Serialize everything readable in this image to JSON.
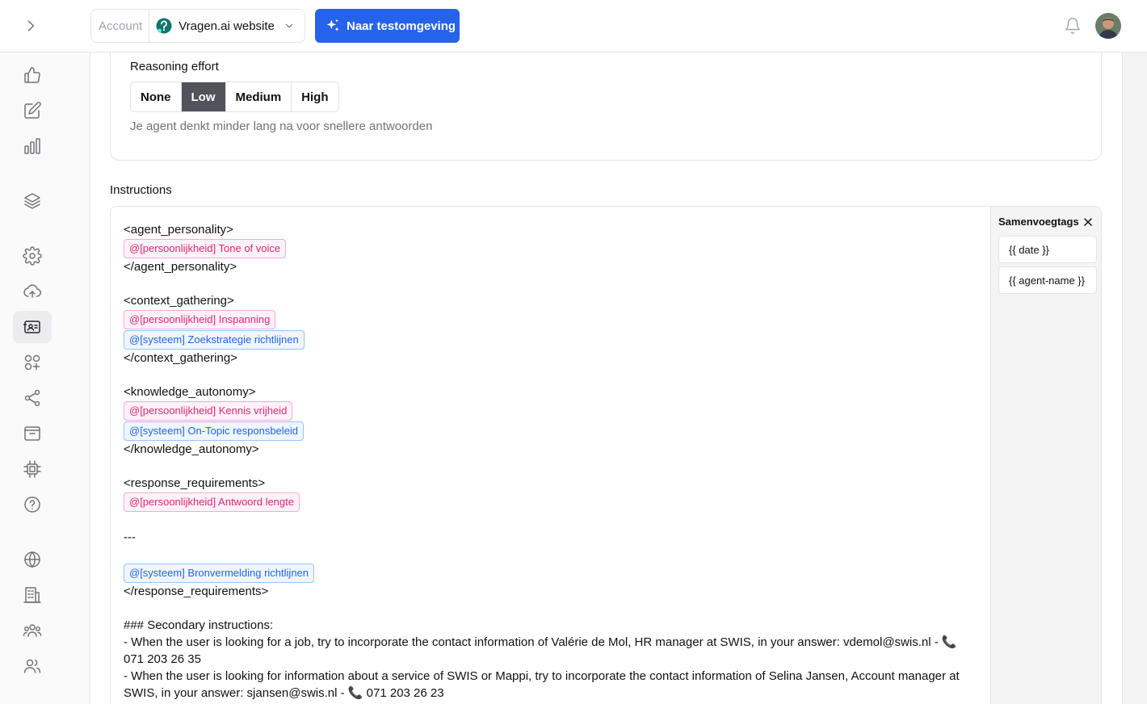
{
  "topbar": {
    "account_label": "Account",
    "account_name": "Vragen.ai website",
    "test_button_label": "Naar testomgeving"
  },
  "sidebar": {
    "items": [
      {
        "icon": "thumbs-up-icon"
      },
      {
        "icon": "edit-icon"
      },
      {
        "icon": "bar-chart-icon"
      },
      {
        "icon": "layers-icon"
      },
      {
        "icon": "gear-icon"
      },
      {
        "icon": "cloud-upload-icon"
      },
      {
        "icon": "id-card-icon",
        "active": true
      },
      {
        "icon": "apps-add-icon"
      },
      {
        "icon": "share-icon"
      },
      {
        "icon": "inbox-icon"
      },
      {
        "icon": "chip-icon"
      },
      {
        "icon": "help-icon"
      },
      {
        "icon": "globe-icon"
      },
      {
        "icon": "building-icon"
      },
      {
        "icon": "team-icon"
      },
      {
        "icon": "users-icon"
      }
    ]
  },
  "reasoning": {
    "title": "Reasoning effort",
    "options": [
      "None",
      "Low",
      "Medium",
      "High"
    ],
    "selected": "Low",
    "help": "Je agent denkt minder lang na voor snellere antwoorden"
  },
  "instructions": {
    "label": "Instructions",
    "lines": {
      "l1": "<agent_personality>",
      "c1": "@[persoonlijkheid] Tone of voice",
      "l2": "</agent_personality>",
      "l3": "<context_gathering>",
      "c2": "@[persoonlijkheid] Inspanning",
      "c3": "@[systeem] Zoekstrategie richtlijnen",
      "l4": "</context_gathering>",
      "l5": "<knowledge_autonomy>",
      "c4": "@[persoonlijkheid] Kennis vrijheid",
      "c5": "@[systeem] On-Topic responsbeleid",
      "l6": "</knowledge_autonomy>",
      "l7": "<response_requirements>",
      "c6": "@[persoonlijkheid] Antwoord lengte",
      "l8": "---",
      "c7": "@[systeem] Bronvermelding richtlijnen",
      "l9": "</response_requirements>",
      "l10": "### Secondary instructions:",
      "l11": "- When the user is looking for a job, try to incorporate the contact information of Valérie de Mol, HR manager at SWIS, in your answer: vdemol@swis.nl - 📞 071 203 26 35",
      "l12": "- When the user is looking for information about a service of SWIS or Mappi, try to incorporate the contact information of Selina Jansen, Account manager at SWIS, in your answer: sjansen@swis.nl - 📞 071 203 26 23"
    }
  },
  "merge_tags": {
    "title": "Samenvoegtags",
    "tags": [
      "{{ date }}",
      "{{ agent-name }}"
    ]
  }
}
